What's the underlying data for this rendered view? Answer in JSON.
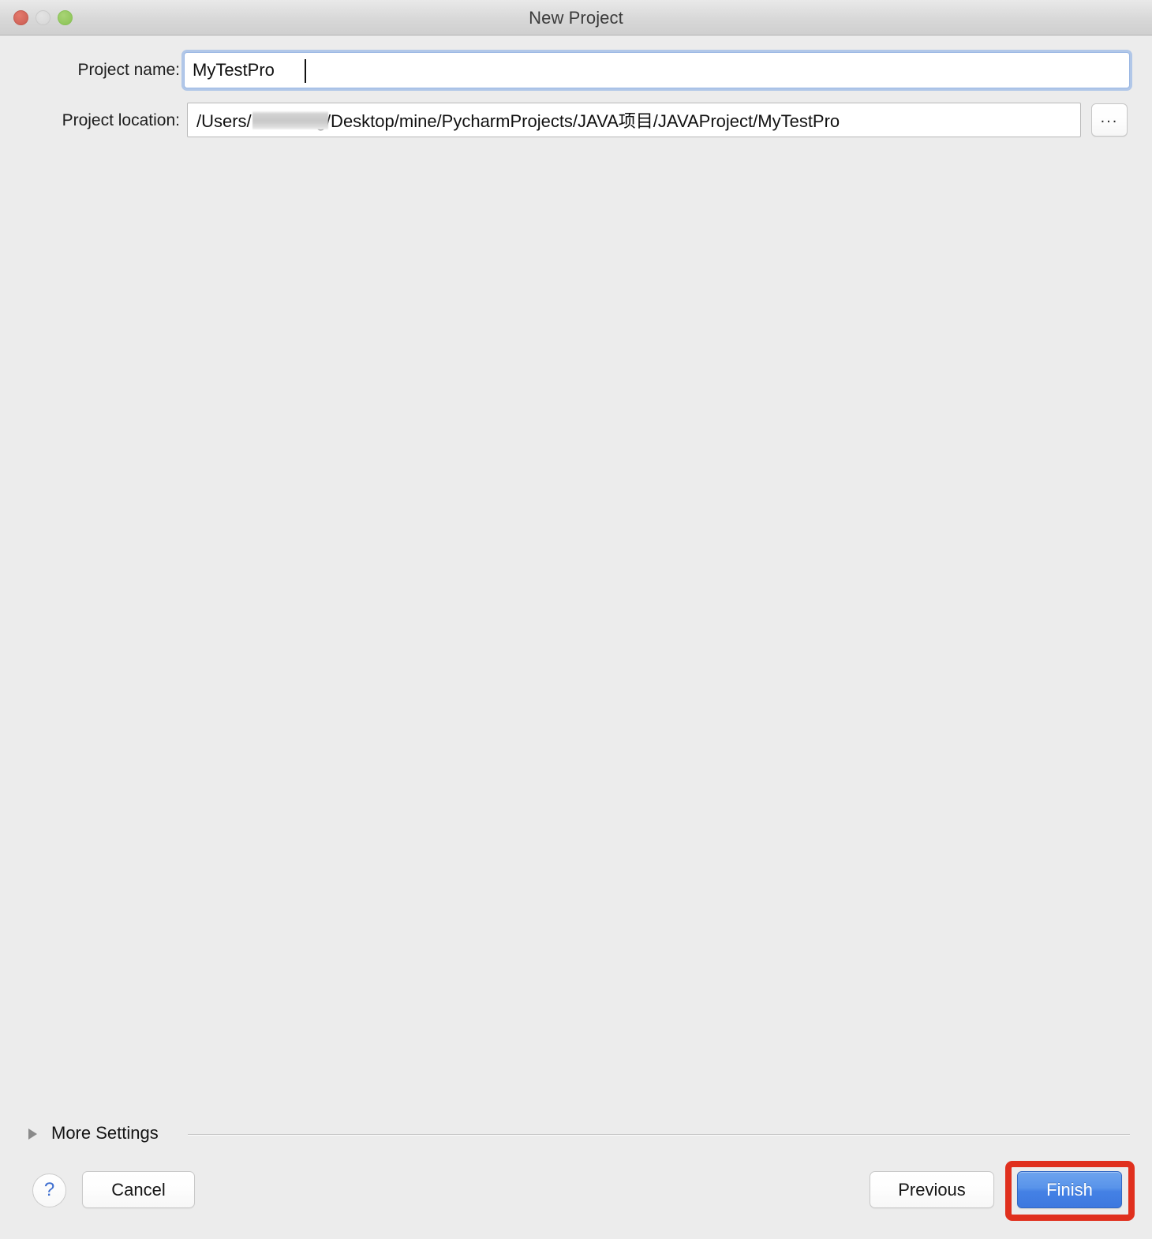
{
  "window": {
    "title": "New Project",
    "traffic_lights": [
      {
        "name": "close",
        "color": "#d1655a"
      },
      {
        "name": "minimize",
        "color": "#dadada"
      },
      {
        "name": "zoom",
        "color": "#93c85e"
      }
    ]
  },
  "form": {
    "project_name": {
      "label": "Project name:",
      "value": "MyTestPro",
      "placeholder": "",
      "focused": true
    },
    "project_location": {
      "label": "Project location:",
      "value_prefix": "/Users/",
      "value_redacted": "",
      "value_suffix": "/Desktop/mine/PycharmProjects/JAVA项目/JAVAProject/MyTestPro",
      "full_value": "/Users/███████/Desktop/mine/PycharmProjects/JAVA项目/JAVAProject/MyTestPro",
      "browse_label": "..."
    }
  },
  "more_settings": {
    "label": "More Settings",
    "expanded": false
  },
  "footer": {
    "help_label": "?",
    "cancel_label": "Cancel",
    "previous_label": "Previous",
    "finish_label": "Finish"
  },
  "annotation": {
    "target": "finish-button",
    "color": "#e0301e"
  }
}
